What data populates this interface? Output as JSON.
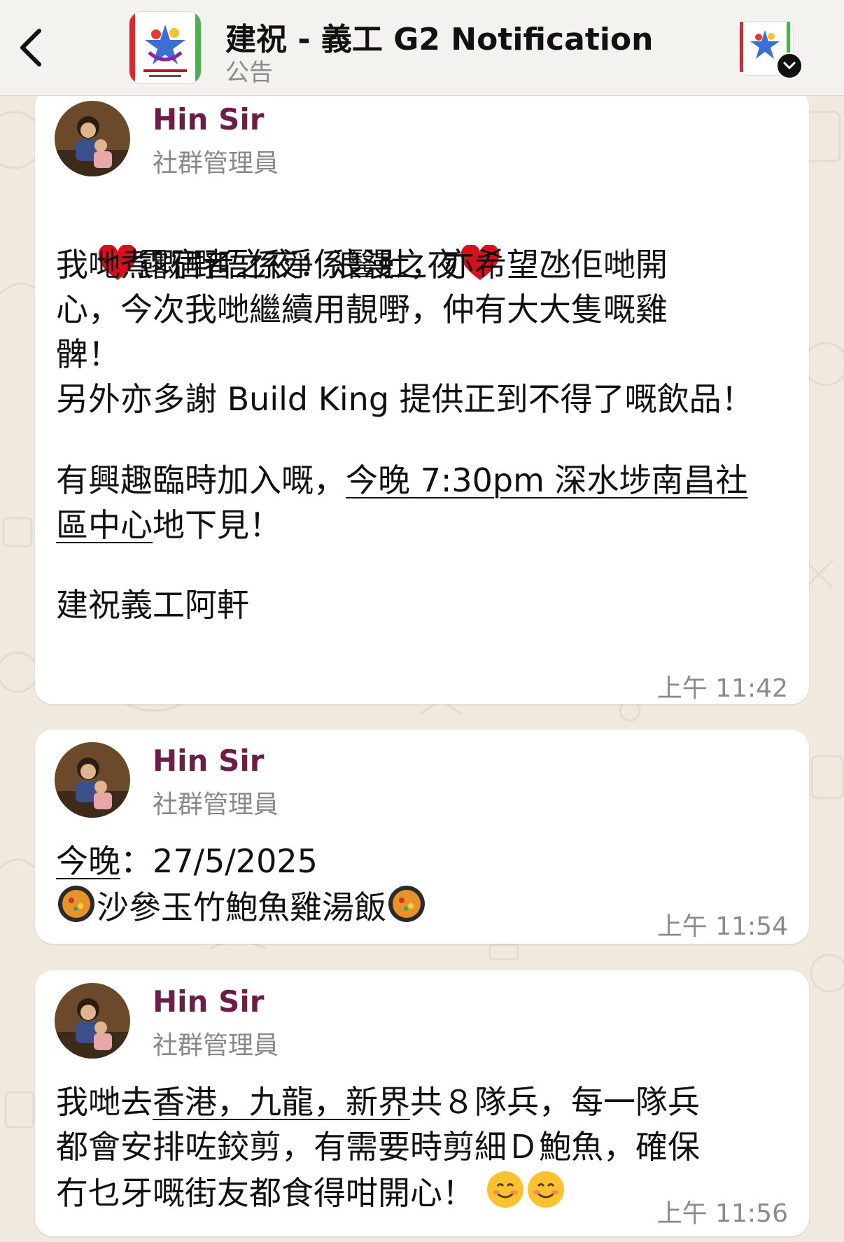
{
  "header": {
    "title": "建祝 - 義工 G2 Notification",
    "subtitle": "公告",
    "back_icon": "chevron-left-icon",
    "community_icon": "chevron-down-icon"
  },
  "messages": [
    {
      "sender": "Hin Sir",
      "role": "社群管理員",
      "title_line": "露宿者之夜：浪漫之夜",
      "para1": "我哋煮嘅嘢唔係淨係醫肚，亦希望氹佢哋開\n心，今次我哋繼續用靚嘢，仲有大大隻嘅雞\n髀！",
      "para2": "另外亦多謝 Build King 提供正到不得了嘅飲品！",
      "para3_a": "有興趣臨時加入嘅，",
      "para3_link1": "今晚 7:30pm 深水埗南昌社",
      "para3_link2": "區中心",
      "para3_b": "地下見！",
      "signature": "建祝義工阿軒",
      "time": "上午 11:42"
    },
    {
      "sender": "Hin Sir",
      "role": "社群管理員",
      "line1_link": "今晚",
      "line1_rest": "：27/5/2025",
      "line2": "沙參玉竹鮑魚雞湯飯",
      "time": "上午 11:54"
    },
    {
      "sender": "Hin Sir",
      "role": "社群管理員",
      "l1_a": "我哋去",
      "l1_link": "香港，九龍，新界",
      "l1_b": "共８隊兵，每一隊兵",
      "l2": "都會安排咗鉸剪，有需要時剪細Ｄ鮑魚，確保",
      "l3": "冇乜牙嘅街友都食得咁開心！",
      "time": "上午 11:56"
    }
  ],
  "colors": {
    "sender": "#6b1f47",
    "background": "#efe9df",
    "timestamp": "#8b8b8b"
  }
}
